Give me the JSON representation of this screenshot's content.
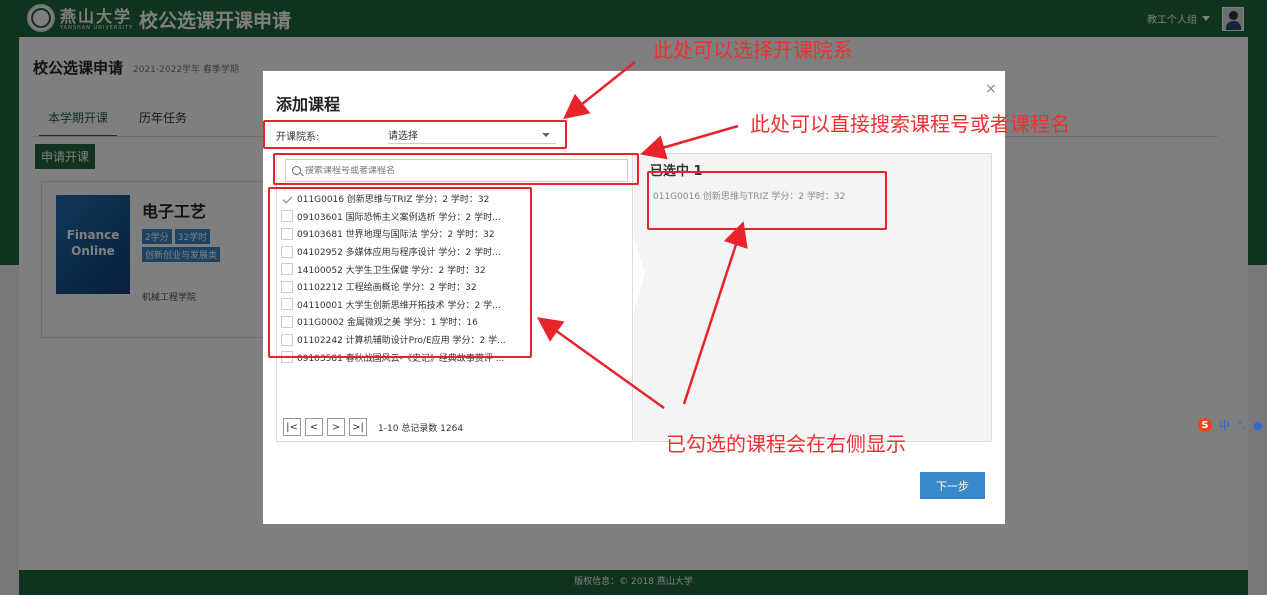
{
  "header": {
    "university_name_cn": "燕山大学",
    "university_name_en": "YANSHAN UNIVERSITY",
    "app_title": "校公选课开课申请",
    "user_menu": "教工个人组"
  },
  "page": {
    "title": "校公选课申请",
    "subtitle": "2021-2022学年 春季学期",
    "tabs": [
      {
        "label": "本学期开课"
      },
      {
        "label": "历年任务"
      }
    ],
    "apply_button": "申请开课"
  },
  "course_card": {
    "cover_line1": "Finance",
    "cover_line2": "Online",
    "name": "电子工艺",
    "credits_badge": "2学分",
    "hours_badge": "32学时",
    "category_badge": "创新创业与发展类",
    "college": "机械工程学院"
  },
  "modal": {
    "title": "添加课程",
    "close": "×",
    "dept_label": "开课院系:",
    "dept_value": "请选择",
    "search_placeholder": "搜索课程号或者课程名",
    "courses": [
      {
        "text": "011G0016 创新思维与TRIZ 学分：2 学时：32",
        "checked": true
      },
      {
        "text": "09103601 国际恐怖主义案例选析 学分：2 学时...",
        "checked": false
      },
      {
        "text": "09103681 世界地理与国际法 学分：2 学时：32",
        "checked": false
      },
      {
        "text": "04102952 多媒体应用与程序设计 学分：2 学时...",
        "checked": false
      },
      {
        "text": "14100052 大学生卫生保健 学分：2 学时：32",
        "checked": false
      },
      {
        "text": "01102212 工程绘画概论 学分：2 学时：32",
        "checked": false
      },
      {
        "text": "04110001 大学生创新思维开拓技术 学分：2 学...",
        "checked": false
      },
      {
        "text": "011G0002 金属微观之美 学分：1 学时：16",
        "checked": false
      },
      {
        "text": "01102242 计算机辅助设计Pro/E应用 学分：2 学...",
        "checked": false
      },
      {
        "text": "09103581 春秋战国风云-《史记》经典故事赏评 ...",
        "checked": false
      }
    ],
    "pager": {
      "first": "|<",
      "prev": "<",
      "next": ">",
      "last": ">|",
      "summary": "1-10 总记录数 1264"
    },
    "selected_title": "已选中 1",
    "selected_items": [
      "011G0016 创新思维与TRIZ 学分：2 学时：32"
    ],
    "next_button": "下一步"
  },
  "annotations": {
    "dept": "此处可以选择开课院系",
    "search": "此处可以直接搜索课程号或者课程名",
    "selected": "已勾选的课程会在右侧显示",
    "color": "#f03030"
  },
  "footer": {
    "copyright": "版权信息：© 2018 燕山大学"
  },
  "ime": {
    "logo": "S",
    "mode": "中"
  }
}
